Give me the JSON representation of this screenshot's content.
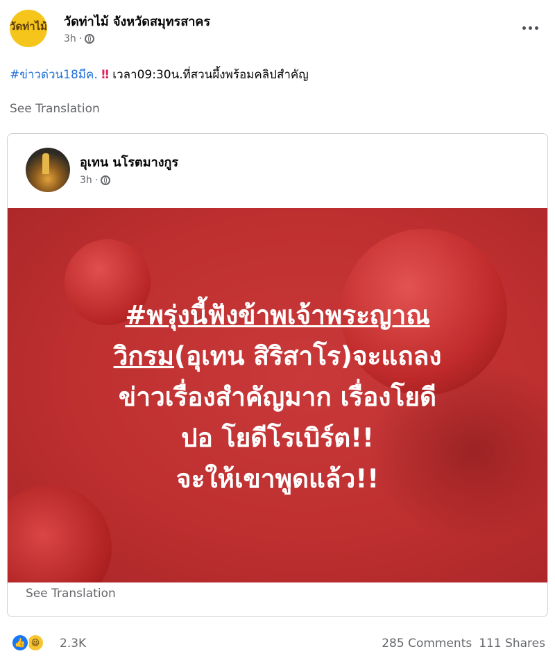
{
  "post": {
    "page_name": "วัดท่าไม้ จังหวัดสมุทรสาคร",
    "avatar_text": "วัดท่าไม้",
    "time": "3h",
    "hashtag": "#ข่าวด่วน18มีค.",
    "emoji": "‼",
    "text": " เวลา09:30น.ที่สวนผึ้งพร้อมคลิปสำคัญ",
    "see_translation": "See Translation"
  },
  "shared": {
    "author": "อุเทน นโรตมางกูร",
    "time": "3h",
    "headline": {
      "line1": "#พรุ่งนี้ฟังข้าพเจ้าพระญาณ",
      "line2_underlined": "วิกรม",
      "line2_rest": "(อุเทน สิริสาโร)จะแถลง",
      "line3": "ข่าวเรื่องสำคัญมาก เรื่องโยดี",
      "line4": "ปอ โยดีโรเบิร์ต!!",
      "line5": "จะให้เขาพูดแล้ว!!"
    },
    "see_translation": "See Translation"
  },
  "stats": {
    "reactions_count": "2.3K",
    "comments": "285 Comments",
    "shares": "111 Shares"
  },
  "icons": {
    "like": "like-reaction-icon",
    "haha": "haha-reaction-icon",
    "globe": "globe-icon",
    "more": "more-options-icon"
  },
  "colors": {
    "hashtag": "#216fdb",
    "image_bg": "#c2302f",
    "like": "#1877f2",
    "haha": "#f7c531"
  }
}
